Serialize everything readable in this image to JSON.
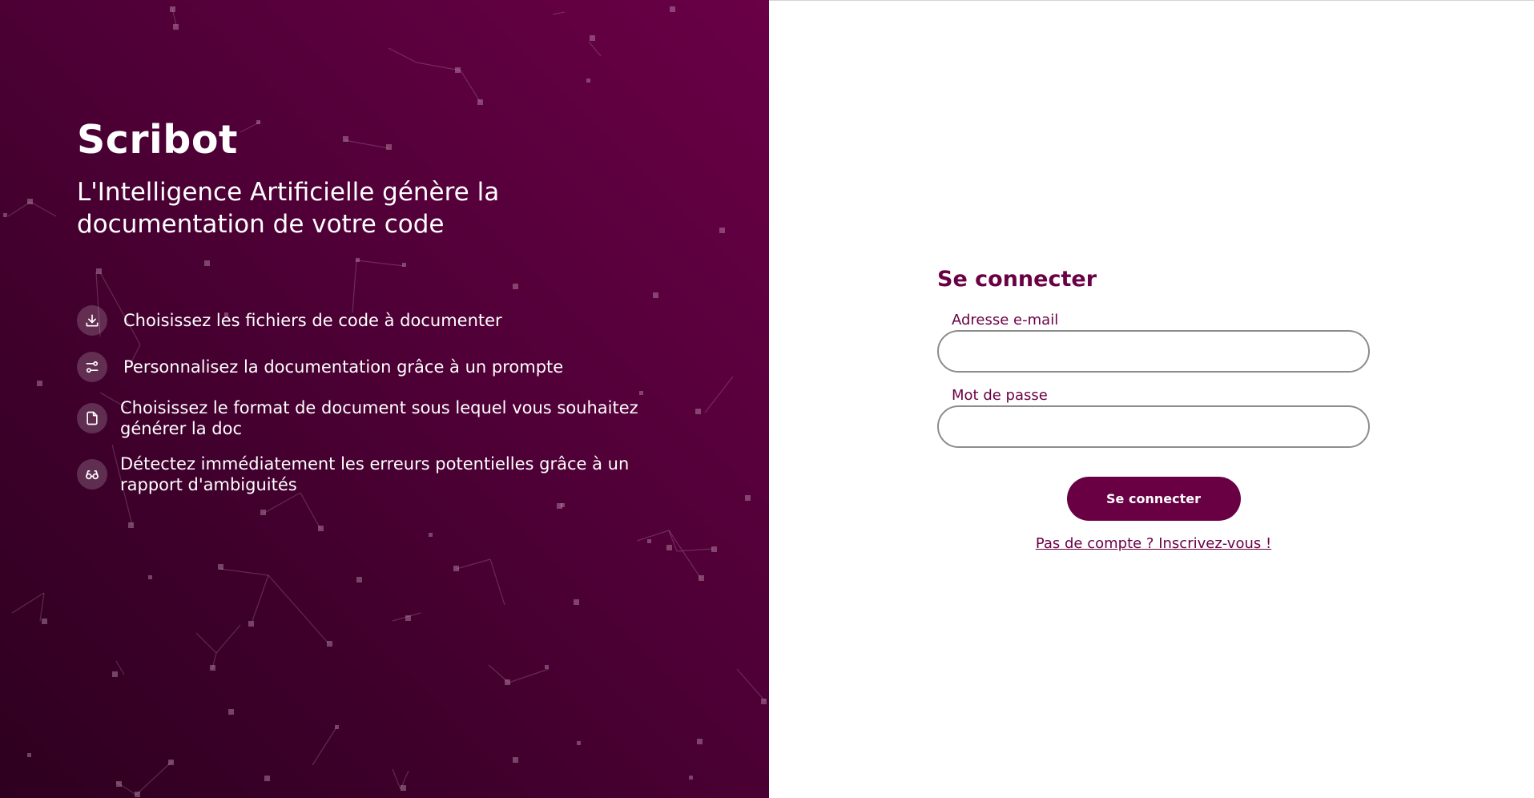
{
  "hero": {
    "brand": "Scribot",
    "tagline": "L'Intelligence Artificielle génère la documentation de votre code",
    "features": [
      {
        "icon": "download-icon",
        "text": "Choisissez les fichiers de code à documenter"
      },
      {
        "icon": "sliders-icon",
        "text": "Personnalisez la documentation grâce à un prompte"
      },
      {
        "icon": "file-icon",
        "text": "Choisissez le format de document sous lequel vous souhaitez générer la doc"
      },
      {
        "icon": "glasses-icon",
        "text": "Détectez immédiatement les erreurs potentielles grâce à un rapport d'ambiguités"
      }
    ]
  },
  "login": {
    "title": "Se connecter",
    "email_label": "Adresse e-mail",
    "email_value": "",
    "password_label": "Mot de passe",
    "password_value": "",
    "submit_label": "Se connecter",
    "signup_link": "Pas de compte ? Inscrivez-vous !"
  },
  "colors": {
    "brand": "#6a0044",
    "hero_gradient_light": "#6a0046",
    "hero_gradient_dark": "#2e001f"
  }
}
